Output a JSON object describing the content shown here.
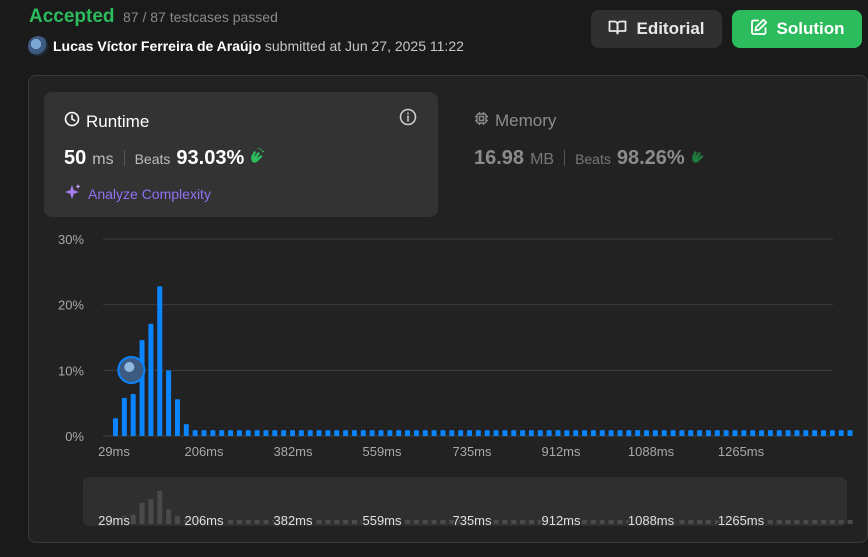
{
  "header": {
    "status": "Accepted",
    "testcases": "87 / 87 testcases passed",
    "submitter": "Lucas Víctor Ferreira de Araújo",
    "submitted_text": "submitted at Jun 27, 2025 11:22",
    "editorial_label": "Editorial",
    "solution_label": "Solution",
    "accent_green": "#2cbb5d"
  },
  "runtime": {
    "title": "Runtime",
    "value": "50",
    "unit": "ms",
    "beats_label": "Beats",
    "beats_pct": "93.03%",
    "analyze_label": "Analyze Complexity"
  },
  "memory": {
    "title": "Memory",
    "value": "16.98",
    "unit": "MB",
    "beats_label": "Beats",
    "beats_pct": "98.26%"
  },
  "chart_data": {
    "type": "bar",
    "y_ticks": [
      "30%",
      "20%",
      "10%",
      "0%"
    ],
    "ylim": [
      0,
      30
    ],
    "x_tick_labels": [
      "29ms",
      "206ms",
      "382ms",
      "559ms",
      "735ms",
      "912ms",
      "1088ms",
      "1265ms"
    ],
    "values": [
      2.7,
      5.8,
      6.4,
      14.6,
      17.1,
      22.8,
      10.0,
      5.6,
      1.8,
      0.9,
      0.9,
      0.9,
      0.9,
      0.9,
      0.9,
      0.9,
      0.9,
      0.9,
      0.9,
      0.9,
      0.9,
      0.9,
      0.9,
      0.9,
      0.9,
      0.9,
      0.9,
      0.9,
      0.9,
      0.9,
      0.9,
      0.9,
      0.9,
      0.9,
      0.9,
      0.9,
      0.9,
      0.9,
      0.9,
      0.9,
      0.9,
      0.9,
      0.9,
      0.9,
      0.9,
      0.9,
      0.9,
      0.9,
      0.9,
      0.9,
      0.9,
      0.9,
      0.9,
      0.9,
      0.9,
      0.9,
      0.9,
      0.9,
      0.9,
      0.9,
      0.9,
      0.9,
      0.9,
      0.9,
      0.9,
      0.9,
      0.9,
      0.9,
      0.9,
      0.9,
      0.9,
      0.9,
      0.9,
      0.9,
      0.9,
      0.9,
      0.9,
      0.9,
      0.9,
      0.9,
      0.9,
      0.9,
      0.9,
      0.9
    ],
    "highlight_index": 1,
    "bar_color": "#0a84ff",
    "mini_bar_color": "#4a4a4a",
    "grid": true
  }
}
